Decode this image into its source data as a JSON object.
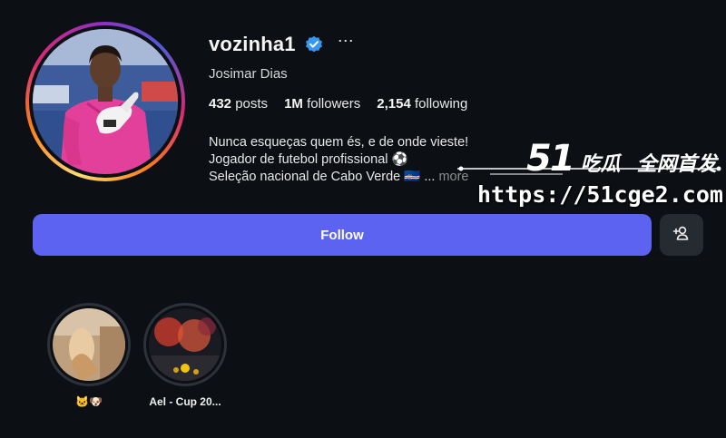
{
  "profile": {
    "username": "vozinha1",
    "full_name": "Josimar Dias",
    "verified": true,
    "more_icon": "⋯",
    "stats": {
      "posts_count": "432",
      "posts_label": "posts",
      "followers_count": "1M",
      "followers_label": "followers",
      "following_count": "2,154",
      "following_label": "following"
    },
    "bio": {
      "line1": "Nunca esqueças quem és, e de onde vieste!",
      "line2": "Jogador de futebol profissional ⚽",
      "line3": "Seleção nacional de Cabo Verde 🇨🇻 ...",
      "more_label": "more"
    }
  },
  "actions": {
    "follow_label": "Follow",
    "add_user_icon": "person-plus-icon"
  },
  "highlights": [
    {
      "label": "🐱🐶",
      "icon": "highlight-cover"
    },
    {
      "label": "Ael - Cup 20...",
      "icon": "highlight-cover"
    }
  ],
  "watermark": {
    "number": "51",
    "brand": "吃瓜",
    "tagline": "全网首发",
    "url": "https://51cge2.com"
  },
  "colors": {
    "background": "#0c0f14",
    "follow_button": "#5b63f0",
    "secondary_button": "#262a31",
    "verified_blue": "#3897f0",
    "muted_text": "#8e8e8e"
  }
}
